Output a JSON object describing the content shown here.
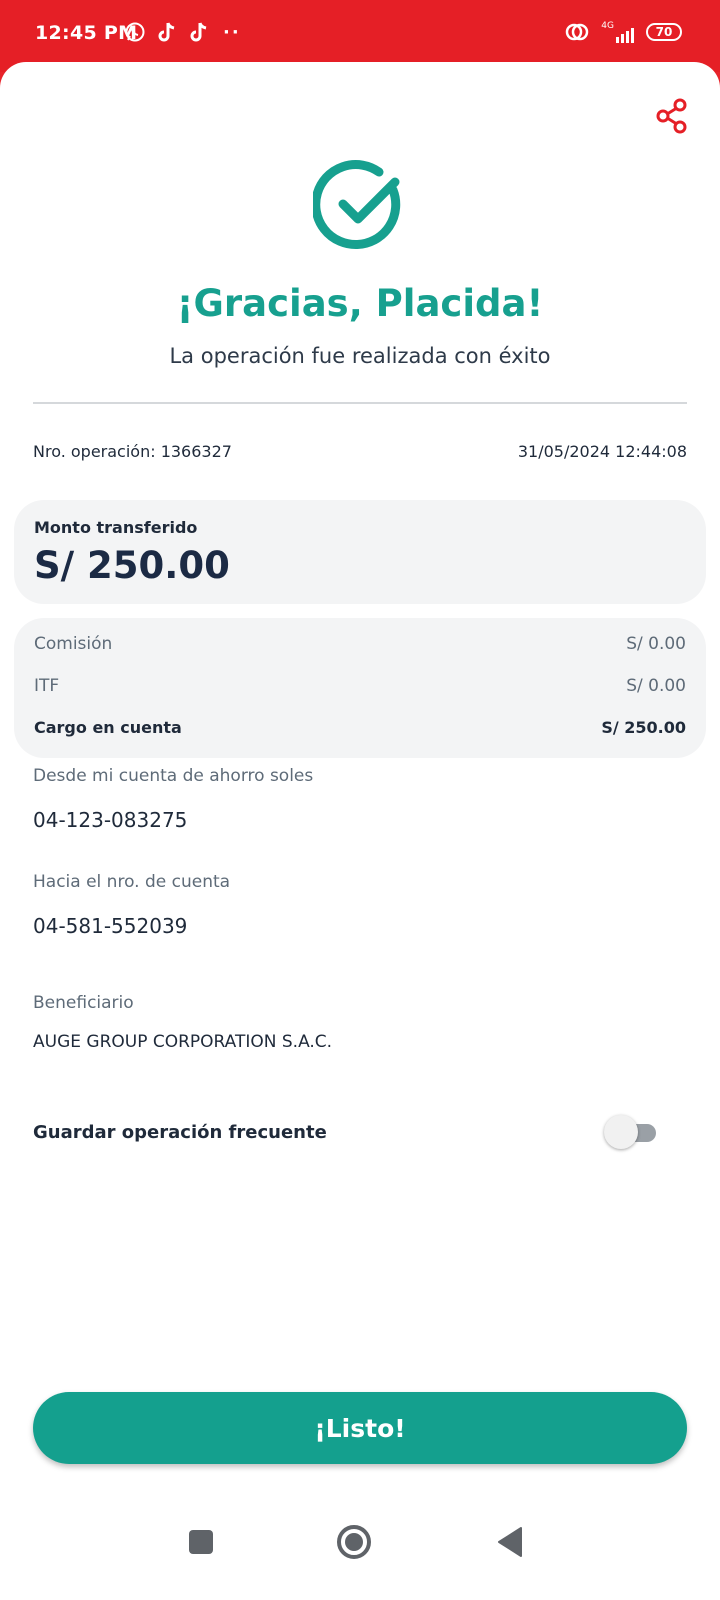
{
  "status_bar": {
    "time": "12:45 PM",
    "battery": "70",
    "network": "4G",
    "icons": [
      "whatsapp-icon",
      "tiktok-icon",
      "tiktok-icon",
      "more-dots",
      "hotspot-icon",
      "signal-icon",
      "battery-icon"
    ]
  },
  "header": {
    "title": "¡Gracias, Placida!",
    "subtitle": "La operación fue realizada con éxito"
  },
  "operation": {
    "number_label": "Nro. operación: 1366327",
    "datetime": "31/05/2024 12:44:08"
  },
  "amount": {
    "label": "Monto transferido",
    "value": "S/ 250.00"
  },
  "fees": [
    {
      "label": "Comisión",
      "value": "S/ 0.00"
    },
    {
      "label": "ITF",
      "value": "S/ 0.00"
    },
    {
      "label": "Cargo en cuenta",
      "value": "S/ 250.00"
    }
  ],
  "from_account": {
    "label": "Desde mi cuenta de ahorro soles",
    "value": "04-123-083275"
  },
  "to_account": {
    "label": "Hacia el nro. de cuenta",
    "value": "04-581-552039"
  },
  "beneficiary": {
    "label": "Beneficiario",
    "value": "AUGE GROUP CORPORATION S.A.C."
  },
  "save_frequent": {
    "label": "Guardar operación frecuente",
    "enabled": false
  },
  "done_button": {
    "label": "¡Listo!"
  },
  "colors": {
    "brand_red": "#e51f26",
    "accent_green": "#17a08f",
    "button_green": "#14a08e"
  }
}
